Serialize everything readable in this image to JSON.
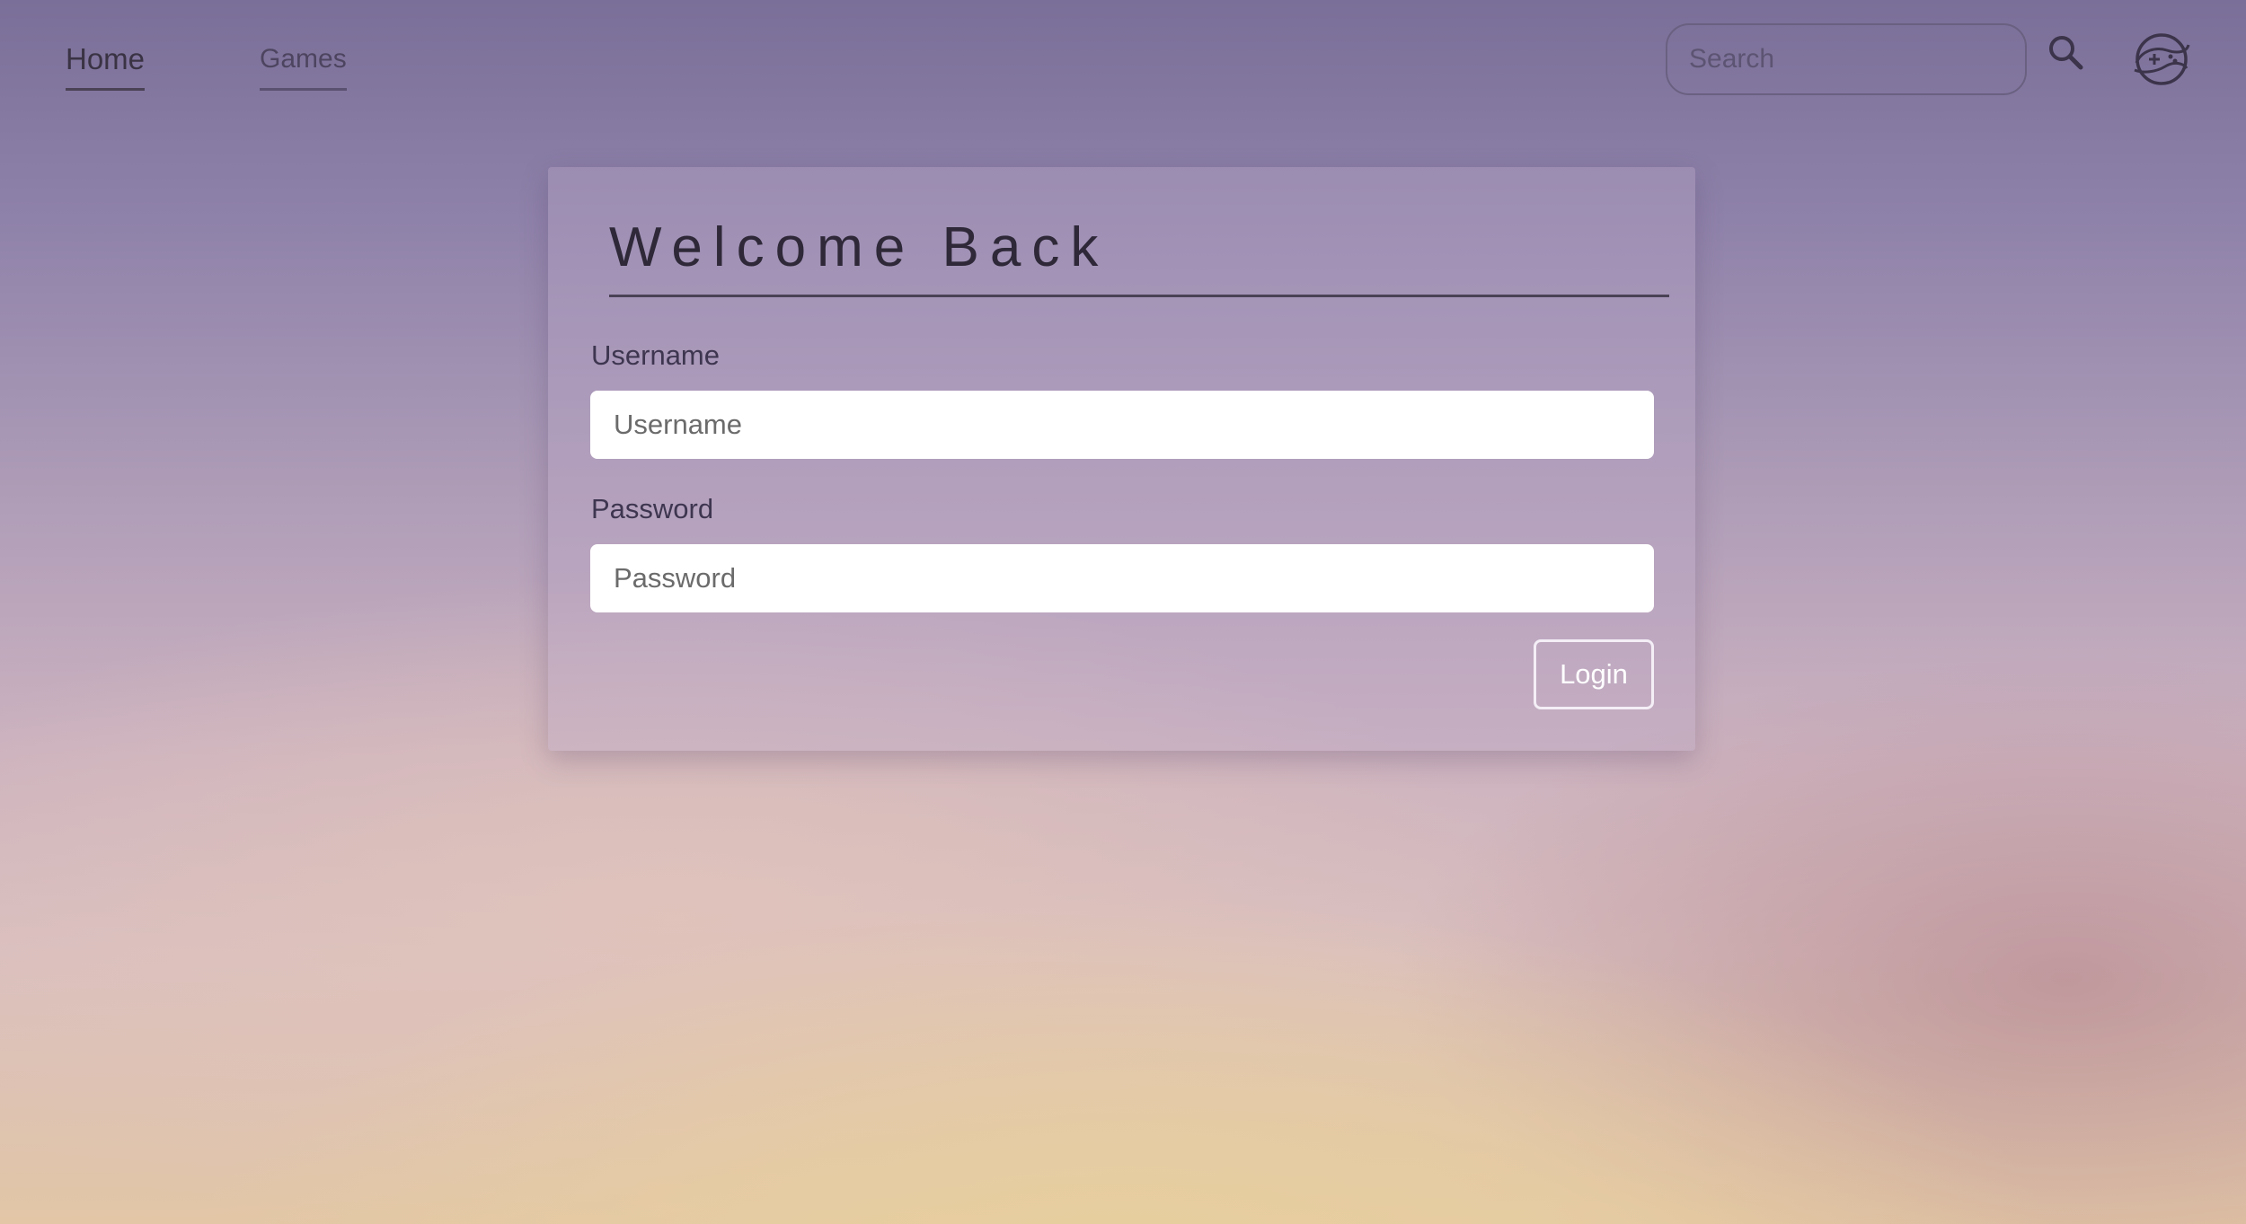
{
  "nav": {
    "links": [
      {
        "label": "Home",
        "active": true
      },
      {
        "label": "Games",
        "active": false
      }
    ],
    "search": {
      "placeholder": "Search",
      "value": ""
    },
    "icons": {
      "search": "magnifier-icon",
      "avatar": "game-controller-avatar-icon"
    }
  },
  "login": {
    "title": "Welcome Back",
    "username": {
      "label": "Username",
      "placeholder": "Username",
      "value": ""
    },
    "password": {
      "label": "Password",
      "placeholder": "Password",
      "value": ""
    },
    "submit_label": "Login"
  },
  "colors": {
    "background_top": "#7a6f98",
    "background_bottom": "#e2c6a6",
    "text_dark": "#2e2838",
    "button_border": "#f4eef6"
  }
}
